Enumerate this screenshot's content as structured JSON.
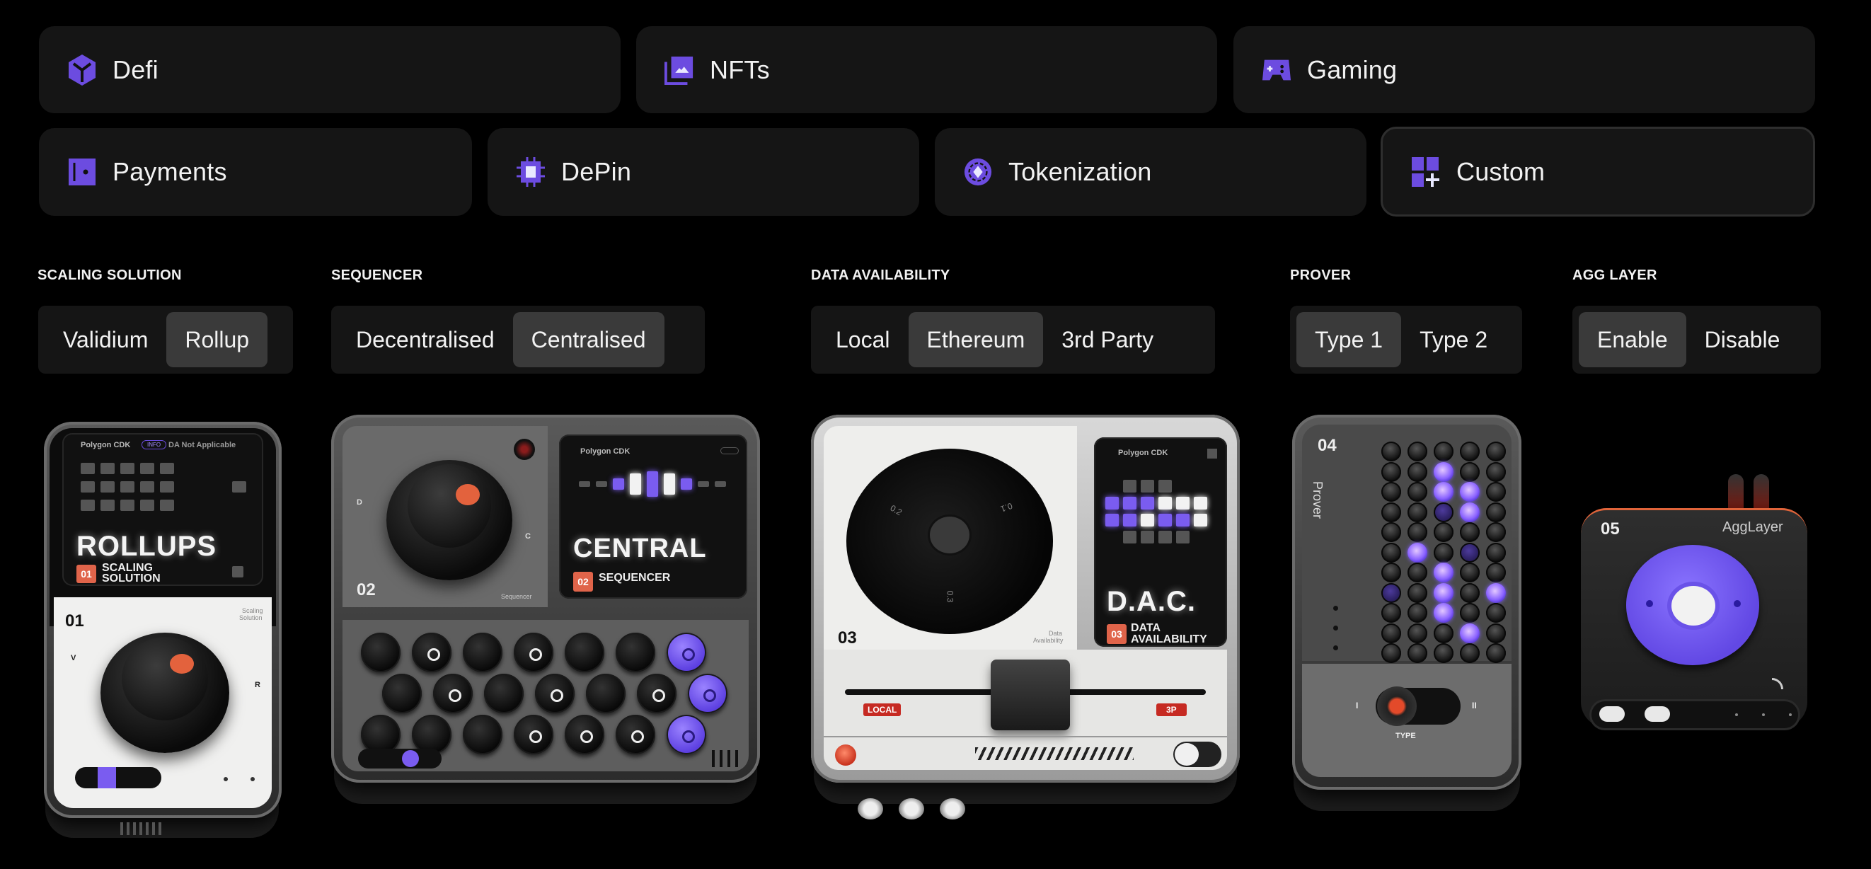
{
  "use_cases": {
    "row1": [
      {
        "label": "Defi",
        "icon": "cube-icon"
      },
      {
        "label": "NFTs",
        "icon": "image-stack-icon"
      },
      {
        "label": "Gaming",
        "icon": "gamepad-icon"
      }
    ],
    "row2": [
      {
        "label": "Payments",
        "icon": "wallet-icon"
      },
      {
        "label": "DePin",
        "icon": "chip-icon"
      },
      {
        "label": "Tokenization",
        "icon": "token-coin-icon"
      },
      {
        "label": "Custom",
        "icon": "grid-plus-icon",
        "selected": true
      }
    ]
  },
  "accent_color": "#6c4ce0",
  "config": [
    {
      "title": "SCALING SOLUTION",
      "options": [
        "Validium",
        "Rollup"
      ],
      "selected": "Rollup"
    },
    {
      "title": "SEQUENCER",
      "options": [
        "Decentralised",
        "Centralised"
      ],
      "selected": "Centralised"
    },
    {
      "title": "DATA AVAILABILITY",
      "options": [
        "Local",
        "Ethereum",
        "3rd Party"
      ],
      "selected": "Ethereum"
    },
    {
      "title": "PROVER",
      "options": [
        "Type 1",
        "Type 2"
      ],
      "selected": "Type 1"
    },
    {
      "title": "AGG LAYER",
      "options": [
        "Enable",
        "Disable"
      ],
      "selected": "Enable"
    }
  ],
  "devices": {
    "d1": {
      "brand": "Polygon CDK",
      "badge": "INFO",
      "note": "DA Not Applicable",
      "headline": "ROLLUPS",
      "tag": "01",
      "tag_label_1": "SCALING",
      "tag_label_2": "SOLUTION",
      "number": "01",
      "caption_1": "Scaling",
      "caption_2": "Solution",
      "left_mark": "V",
      "right_mark": "R"
    },
    "d2": {
      "brand": "Polygon CDK",
      "headline": "CENTRAL",
      "tag": "02",
      "tag_label": "SEQUENCER",
      "number": "02",
      "caption": "Sequencer",
      "left_mark": "D",
      "right_mark": "C"
    },
    "d3": {
      "brand": "Polygon CDK",
      "headline": "D.A.C.",
      "tag": "03",
      "tag_label_1": "DATA",
      "tag_label_2": "AVAILABILITY",
      "number": "03",
      "caption_1": "Data",
      "caption_2": "Availability",
      "dial_1": "0.1",
      "dial_2": "0.2",
      "dial_3": "0.3",
      "left_chip": "LOCAL",
      "right_chip": "3P"
    },
    "d4": {
      "number": "04",
      "label": "Prover",
      "switch_left": "I",
      "switch_right": "II",
      "switch_label": "TYPE"
    },
    "d5": {
      "number": "05",
      "label": "AggLayer"
    }
  }
}
